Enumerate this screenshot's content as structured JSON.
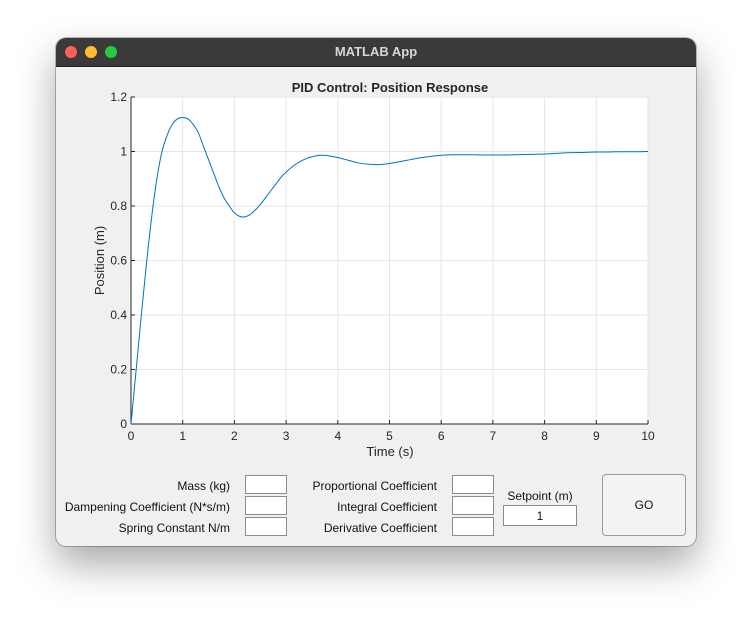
{
  "window": {
    "title": "MATLAB App"
  },
  "chart_data": {
    "type": "line",
    "title": "PID Control: Position Response",
    "xlabel": "Time (s)",
    "ylabel": "Position (m)",
    "xlim": [
      0,
      10
    ],
    "ylim": [
      0,
      1.2
    ],
    "xticks": [
      "0",
      "1",
      "2",
      "3",
      "4",
      "5",
      "6",
      "7",
      "8",
      "9",
      "10"
    ],
    "yticks": [
      "0",
      "0.2",
      "0.4",
      "0.6",
      "0.8",
      "1",
      "1.2"
    ],
    "grid": true,
    "line_color": "#0072BD",
    "x": [
      0,
      0.1,
      0.2,
      0.3,
      0.4,
      0.5,
      0.6,
      0.7,
      0.8,
      0.9,
      1.0,
      1.1,
      1.2,
      1.3,
      1.4,
      1.5,
      1.6,
      1.7,
      1.8,
      1.9,
      2.0,
      2.1,
      2.2,
      2.3,
      2.4,
      2.5,
      2.6,
      2.7,
      2.8,
      2.9,
      3.0,
      3.2,
      3.4,
      3.6,
      3.7,
      3.8,
      4.0,
      4.2,
      4.4,
      4.6,
      4.8,
      5.0,
      5.2,
      5.4,
      5.6,
      5.8,
      6.0,
      6.2,
      6.4,
      6.6,
      6.8,
      7.0,
      7.2,
      7.4,
      7.6,
      7.8,
      8.0,
      8.2,
      8.4,
      8.6,
      8.8,
      9.0,
      9.2,
      9.4,
      9.6,
      9.8,
      10.0
    ],
    "y": [
      0,
      0.2,
      0.4,
      0.59,
      0.76,
      0.9,
      1.0,
      1.06,
      1.1,
      1.12,
      1.125,
      1.12,
      1.1,
      1.07,
      1.02,
      0.97,
      0.92,
      0.87,
      0.83,
      0.8,
      0.775,
      0.762,
      0.76,
      0.768,
      0.785,
      0.805,
      0.83,
      0.855,
      0.88,
      0.905,
      0.925,
      0.955,
      0.975,
      0.985,
      0.986,
      0.985,
      0.978,
      0.968,
      0.958,
      0.953,
      0.952,
      0.956,
      0.963,
      0.97,
      0.977,
      0.982,
      0.986,
      0.988,
      0.988,
      0.988,
      0.987,
      0.987,
      0.987,
      0.988,
      0.989,
      0.99,
      0.991,
      0.993,
      0.995,
      0.996,
      0.997,
      0.998,
      0.998,
      0.999,
      0.999,
      0.999,
      1.0
    ]
  },
  "params": {
    "mass_label": "Mass (kg)",
    "mass_value": "",
    "damping_label": "Dampening Coefficient (N*s/m)",
    "damping_value": "",
    "spring_label": "Spring Constant N/m",
    "spring_value": "",
    "p_label": "Proportional Coefficient",
    "p_value": "",
    "i_label": "Integral Coefficient",
    "i_value": "",
    "d_label": "Derivative Coefficient",
    "d_value": "",
    "setpoint_label": "Setpoint (m)",
    "setpoint_value": "1",
    "go_label": "GO"
  }
}
